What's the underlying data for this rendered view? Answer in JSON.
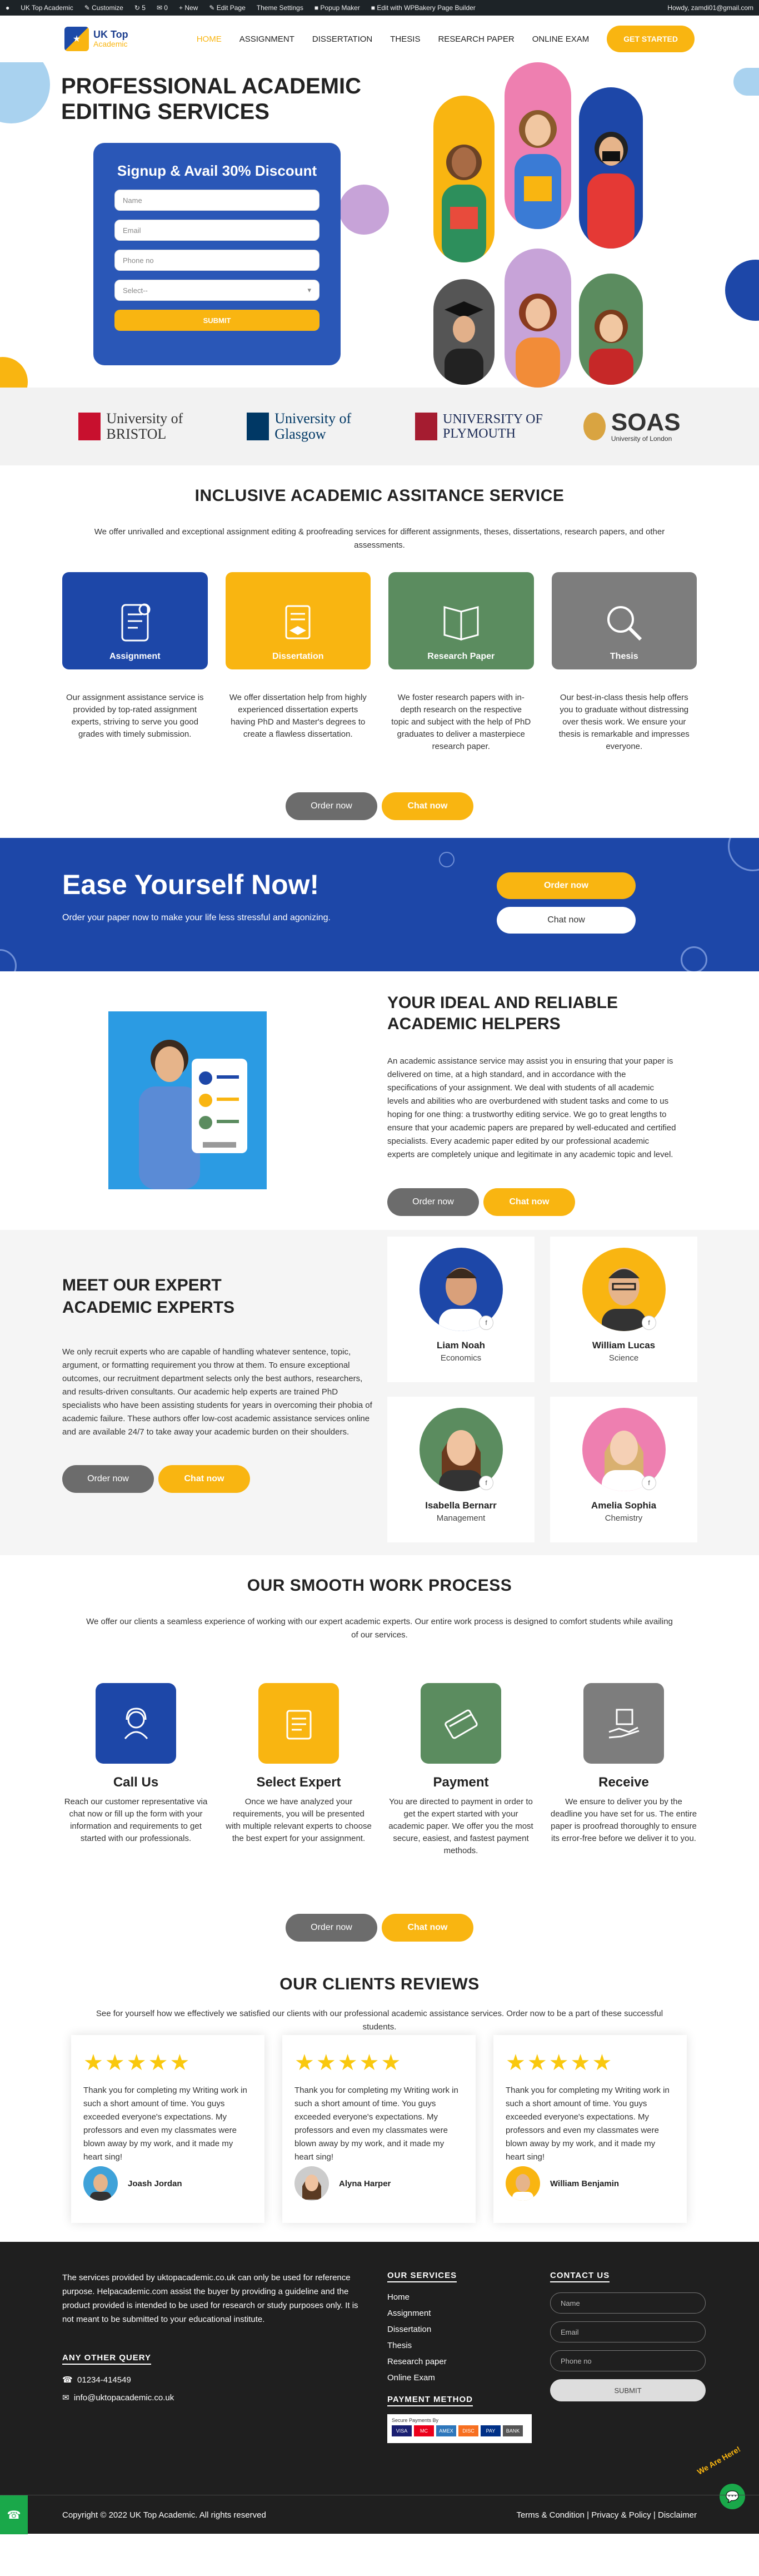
{
  "adminbar": {
    "items": [
      "UK Top Academic",
      "Customize",
      "5",
      "0",
      "+ New",
      "Edit Page",
      "Theme Settings",
      "Popup Maker",
      "Edit with WPBakery Page Builder"
    ],
    "user": "Howdy, zamdi01@gmail.com"
  },
  "header": {
    "logo_line1": "UK Top",
    "logo_line2": "Academic",
    "nav": [
      "HOME",
      "ASSIGNMENT",
      "DISSERTATION",
      "THESIS",
      "RESEARCH PAPER",
      "ONLINE EXAM"
    ],
    "cta": "GET STARTED"
  },
  "hero": {
    "title": "PROFESSIONAL ACADEMIC EDITING SERVICES",
    "form_title": "Signup & Avail 30% Discount",
    "placeholders": [
      "Name",
      "Email",
      "Phone no",
      "Select--"
    ],
    "submit": "SUBMIT"
  },
  "universities": [
    "University of BRISTOL",
    "University of Glasgow",
    "UNIVERSITY OF PLYMOUTH",
    "SOAS"
  ],
  "soas_sub": "University of London",
  "services": {
    "title": "INCLUSIVE ACADEMIC ASSITANCE SERVICE",
    "subtitle": "We offer unrivalled and exceptional assignment editing & proofreading services for different assignments, theses, dissertations, research papers, and other assessments.",
    "cards": [
      {
        "label": "Assignment",
        "text": "Our assignment assistance service is provided by top-rated assignment experts, striving to serve you good grades with timely submission.",
        "color": "#1d47a8"
      },
      {
        "label": "Dissertation",
        "text": "We offer dissertation help from highly experienced dissertation experts having PhD and Master's degrees to create a flawless dissertation.",
        "color": "#f9b511"
      },
      {
        "label": "Research Paper",
        "text": "We foster research papers with in-depth research on the respective topic and subject with the help of PhD graduates to deliver a masterpiece research paper.",
        "color": "#5b8c5f"
      },
      {
        "label": "Thesis",
        "text": "Our best-in-class thesis help offers you to graduate without distressing over thesis work. We ensure your thesis is remarkable and impresses everyone.",
        "color": "#7d7d7d"
      }
    ],
    "order": "Order now",
    "chat": "Chat now"
  },
  "ease": {
    "title": "Ease Yourself Now!",
    "text": "Order your paper now to make your life less stressful and agonizing.",
    "order": "Order now",
    "chat": "Chat now"
  },
  "ideal": {
    "title": "YOUR IDEAL AND RELIABLE ACADEMIC HELPERS",
    "text": "An academic assistance service may assist you in ensuring that your paper is delivered on time, at a high standard, and in accordance with the specifications of your assignment. We deal with students of all academic levels and abilities who are overburdened with student tasks and come to us hoping for one thing: a trustworthy editing service. We go to great lengths to ensure that your academic papers are prepared by well-educated and certified specialists. Every academic paper edited by our professional academic experts are completely unique and legitimate in any academic topic and level.",
    "order": "Order now",
    "chat": "Chat now"
  },
  "experts": {
    "title": "MEET OUR EXPERT ACADEMIC EXPERTS",
    "text": "We only recruit experts who are capable of handling whatever sentence, topic, argument, or formatting requirement you throw at them. To ensure exceptional outcomes, our recruitment department selects only the best authors, researchers, and results-driven consultants. Our academic help experts are trained PhD specialists who have been assisting students for years in overcoming their phobia of academic failure. These authors offer low-cost academic assistance services online and are available 24/7 to take away your academic burden on their shoulders.",
    "order": "Order now",
    "chat": "Chat now",
    "people": [
      {
        "name": "Liam Noah",
        "role": "Economics",
        "bg": "#1d47a8"
      },
      {
        "name": "William Lucas",
        "role": "Science",
        "bg": "#f9b511"
      },
      {
        "name": "Isabella Bernarr",
        "role": "Management",
        "bg": "#5b8c5f"
      },
      {
        "name": "Amelia Sophia",
        "role": "Chemistry",
        "bg": "#ee7fb0"
      }
    ]
  },
  "process": {
    "title": "OUR SMOOTH WORK PROCESS",
    "subtitle": "We offer our clients a seamless experience of working with our expert academic experts. Our entire work process is designed to comfort students while availing of our services.",
    "steps": [
      {
        "title": "Call Us",
        "text": "Reach our customer representative via chat now or fill up the form with your information and requirements to get started with our professionals.",
        "color": "#1d47a8"
      },
      {
        "title": "Select Expert",
        "text": "Once we have analyzed your requirements, you will be presented with multiple relevant experts to choose the best expert for your assignment.",
        "color": "#f9b511"
      },
      {
        "title": "Payment",
        "text": "You are directed to payment in order to get the expert started with your academic paper. We offer you the most secure, easiest, and fastest payment methods.",
        "color": "#5b8c5f"
      },
      {
        "title": "Receive",
        "text": "We ensure to deliver you by the deadline you have set for us. The entire paper is proofread thoroughly to ensure its error-free before we deliver it to you.",
        "color": "#7d7d7d"
      }
    ],
    "order": "Order now",
    "chat": "Chat now"
  },
  "reviews": {
    "title": "OUR CLIENTS REVIEWS",
    "subtitle": "See for yourself how we effectively we satisfied our clients with our professional academic assistance services. Order now to be a part of these successful students.",
    "stars": "★★★★★",
    "items": [
      {
        "text": "Thank you for completing my Writing work in such a short amount of time. You guys exceeded everyone's expectations. My professors and even my classmates were blown away by my work, and it made my heart sing!",
        "name": "Joash Jordan"
      },
      {
        "text": "Thank you for completing my Writing work in such a short amount of time. You guys exceeded everyone's expectations. My professors and even my classmates were blown away by my work, and it made my heart sing!",
        "name": "Alyna Harper"
      },
      {
        "text": "Thank you for completing my Writing work in such a short amount of time. You guys exceeded everyone's expectations. My professors and even my classmates were blown away by my work, and it made my heart sing!",
        "name": "William Benjamin"
      }
    ]
  },
  "footer": {
    "about": "The services provided by uktopacademic.co.uk can only be used for reference purpose. Helpacademic.com assist the buyer by providing a guideline and the product provided is intended to be used for research or study purposes only. It is not meant to be submitted to your educational institute.",
    "query_title": "ANY OTHER QUERY",
    "phone": "01234-414549",
    "email": "info@uktopacademic.co.uk",
    "services_title": "OUR SERVICES",
    "services": [
      "Home",
      "Assignment",
      "Dissertation",
      "Thesis",
      "Research paper",
      "Online Exam"
    ],
    "payment_title": "PAYMENT METHOD",
    "secure": "Secure Payments By",
    "cards": [
      "VISA",
      "MC",
      "AMEX",
      "DISC",
      "PAY",
      "BANK"
    ],
    "contact_title": "CONTACT US",
    "placeholders": [
      "Name",
      "Email",
      "Phone no"
    ],
    "submit": "SUBMIT",
    "copyright": "Copyright © 2022 UK Top Academic. All rights reserved",
    "links": "Terms & Condition | Privacy & Policy | Disclaimer",
    "chat_badge": "We Are Here!"
  }
}
